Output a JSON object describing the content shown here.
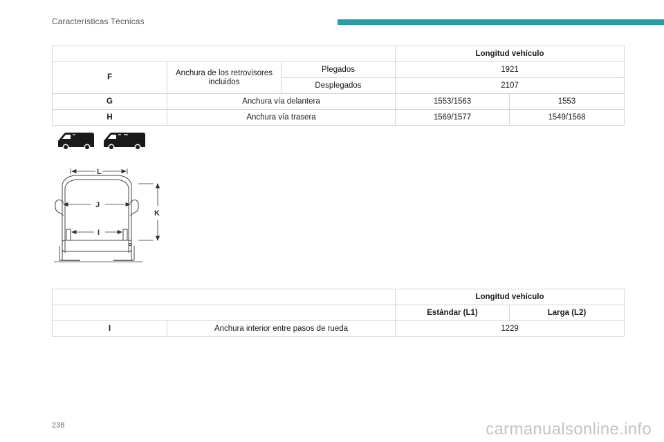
{
  "header": {
    "section_title": "Características Técnicas"
  },
  "table1": {
    "header_label": "Longitud vehículo",
    "rows": [
      {
        "code": "F",
        "label": "Anchura de los retrovisores incluidos",
        "sub": "Plegados",
        "value": "1921"
      },
      {
        "sub": "Desplegados",
        "value": "2107"
      },
      {
        "code": "G",
        "label": "Anchura vía delantera",
        "value_1": "1553/1563",
        "value_2": "1553"
      },
      {
        "code": "H",
        "label": "Anchura vía trasera",
        "value_1": "1569/1577",
        "value_2": "1549/1568"
      }
    ]
  },
  "diagram": {
    "icons": [
      "van-short-icon",
      "van-long-icon"
    ],
    "labels": {
      "L": "L",
      "J": "J",
      "I": "I",
      "K": "K"
    }
  },
  "table2": {
    "header_label": "Longitud vehículo",
    "col_1": "Estándar (L1)",
    "col_2": "Larga (L2)",
    "rows": [
      {
        "code": "I",
        "label": "Anchura interior entre pasos de rueda",
        "value": "1229"
      }
    ]
  },
  "footer": {
    "page_number": "238",
    "watermark": "carmanualsonline.info"
  }
}
